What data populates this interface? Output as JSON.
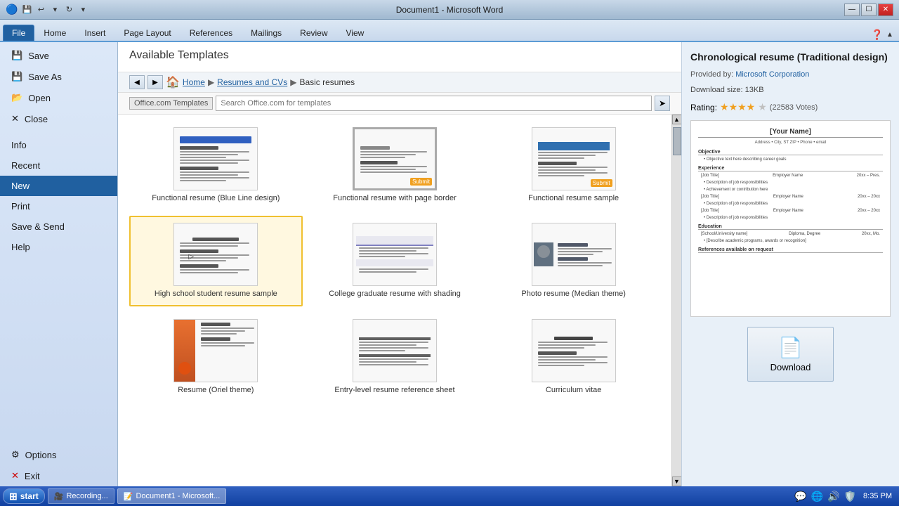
{
  "titleBar": {
    "title": "Document1  -  Microsoft Word",
    "minBtn": "—",
    "maxBtn": "☐",
    "closeBtn": "✕"
  },
  "ribbonTabs": [
    {
      "label": "File",
      "active": true
    },
    {
      "label": "Home"
    },
    {
      "label": "Insert"
    },
    {
      "label": "Page Layout"
    },
    {
      "label": "References"
    },
    {
      "label": "Mailings"
    },
    {
      "label": "Review"
    },
    {
      "label": "View"
    }
  ],
  "sidebar": {
    "items": [
      {
        "label": "Save",
        "icon": "💾",
        "active": false
      },
      {
        "label": "Save As",
        "icon": "💾",
        "active": false
      },
      {
        "label": "Open",
        "icon": "📂",
        "active": false
      },
      {
        "label": "Close",
        "icon": "✕",
        "active": false
      },
      {
        "label": "Info",
        "active": false
      },
      {
        "label": "Recent",
        "active": false
      },
      {
        "label": "New",
        "active": true
      },
      {
        "label": "Print",
        "active": false
      },
      {
        "label": "Save & Send",
        "active": false
      },
      {
        "label": "Help",
        "active": false
      },
      {
        "label": "Options",
        "icon": "⚙",
        "active": false
      },
      {
        "label": "Exit",
        "icon": "🚪",
        "active": false
      }
    ]
  },
  "templates": {
    "sectionTitle": "Available Templates",
    "breadcrumb": {
      "home": "Home",
      "items": [
        "Resumes and CVs",
        "Basic resumes"
      ]
    },
    "searchLabel": "Office.com Templates",
    "searchPlaceholder": "Search Office.com for templates",
    "items": [
      {
        "label": "Functional resume (Blue Line design)",
        "selected": false,
        "hasSubmit": false
      },
      {
        "label": "Functional resume with page border",
        "selected": false,
        "hasSubmit": true
      },
      {
        "label": "Functional resume sample",
        "selected": false,
        "hasSubmit": true
      },
      {
        "label": "High school student resume sample",
        "selected": true,
        "hasSubmit": false
      },
      {
        "label": "College graduate resume with shading",
        "selected": false,
        "hasSubmit": false
      },
      {
        "label": "Photo resume (Median theme)",
        "selected": false,
        "hasSubmit": false
      },
      {
        "label": "Resume (Oriel theme)",
        "selected": false,
        "hasSubmit": false
      },
      {
        "label": "Entry-level resume reference sheet",
        "selected": false,
        "hasSubmit": false
      },
      {
        "label": "Curriculum vitae",
        "selected": false,
        "hasSubmit": false
      }
    ]
  },
  "rightPanel": {
    "title": "Chronological resume (Traditional design)",
    "provider": "Microsoft Corporation",
    "downloadSize": "Download size: 13KB",
    "ratingLabel": "Rating:",
    "stars": 4,
    "halfStar": true,
    "votes": "(22583 Votes)",
    "downloadBtn": "Download"
  },
  "taskbar": {
    "startLabel": "start",
    "app1": "Recording...",
    "app2": "Document1 - Microsoft...",
    "time": "8:35 PM"
  }
}
